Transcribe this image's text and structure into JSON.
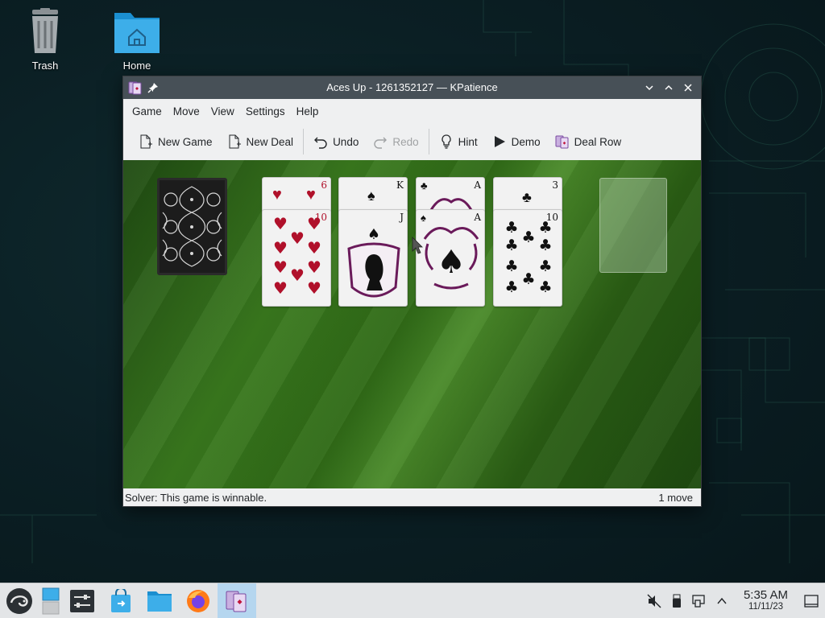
{
  "desktop": {
    "icons": [
      {
        "label": "Trash"
      },
      {
        "label": "Home"
      }
    ]
  },
  "window": {
    "title": "Aces Up - 1261352127 — KPatience",
    "menu": [
      "Game",
      "Move",
      "View",
      "Settings",
      "Help"
    ],
    "toolbar": {
      "new_game": "New Game",
      "new_deal": "New Deal",
      "undo": "Undo",
      "redo": "Redo",
      "hint": "Hint",
      "demo": "Demo",
      "deal_row": "Deal Row"
    },
    "status": {
      "solver": "Solver: This game is winnable.",
      "moves": "1 move"
    }
  },
  "piles": [
    {
      "under": {
        "rank": "6",
        "suit": "hearts"
      },
      "top": {
        "rank": "10",
        "suit": "hearts"
      }
    },
    {
      "under": {
        "rank": "K",
        "suit": "spades"
      },
      "top": {
        "rank": "J",
        "suit": "spades"
      }
    },
    {
      "under": {
        "rank": "A",
        "suit": "clubs"
      },
      "top": {
        "rank": "A",
        "suit": "spades"
      }
    },
    {
      "under": {
        "rank": "3",
        "suit": "clubs"
      },
      "top": {
        "rank": "10",
        "suit": "clubs"
      }
    }
  ],
  "taskbar": {
    "clock_time": "5:35 AM",
    "clock_date": "11/11/23"
  },
  "colors": {
    "felt": "#3a7a1e",
    "titlebar": "#475057",
    "taskbar_active": "#b5d6ef",
    "heart_red": "#b0102a"
  }
}
